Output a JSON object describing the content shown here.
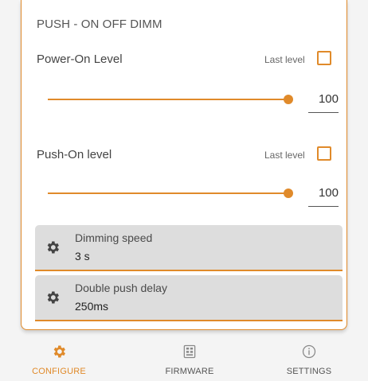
{
  "section": {
    "title": "PUSH - ON OFF DIMM"
  },
  "power_on": {
    "label": "Power-On Level",
    "last_level_label": "Last level",
    "last_level_checked": false,
    "value": "100",
    "slider_fraction": 1.0
  },
  "push_on": {
    "label": "Push-On level",
    "last_level_label": "Last level",
    "last_level_checked": false,
    "value": "100",
    "slider_fraction": 1.0
  },
  "dimming_speed": {
    "label": "Dimming speed",
    "value": "3 s",
    "icon": "gear-icon"
  },
  "double_push": {
    "label": "Double push delay",
    "value": "250ms",
    "icon": "gear-icon"
  },
  "nav": {
    "items": [
      {
        "label": "CONFIGURE",
        "icon": "gear-icon",
        "active": true
      },
      {
        "label": "FIRMWARE",
        "icon": "firmware-icon",
        "active": false
      },
      {
        "label": "SETTINGS",
        "icon": "info-icon",
        "active": false
      }
    ]
  },
  "colors": {
    "accent": "#e08a2a",
    "field_bg": "#dddddd",
    "text": "#444444"
  }
}
